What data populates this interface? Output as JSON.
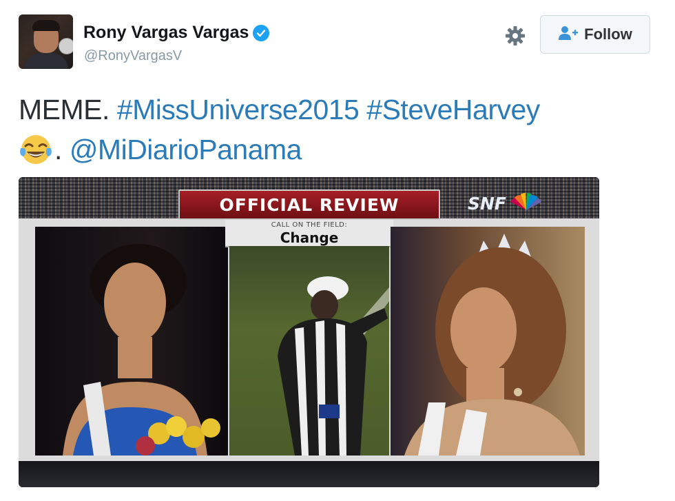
{
  "tweet": {
    "author": {
      "display_name": "Rony Vargas Vargas",
      "handle": "@RonyVargasV",
      "verified": true
    },
    "follow_button_label": "Follow",
    "text": {
      "prefix": "MEME.",
      "hashtag_1": "#MissUniverse2015",
      "hashtag_2": "#SteveHarvey",
      "emoji": "face-with-tears-of-joy",
      "separator": ".",
      "mention": "@MiDiarioPanama"
    },
    "media": {
      "banner_text": "OFFICIAL REVIEW",
      "network_logo_text": "SNF",
      "call_label": "CALL ON THE FIELD:",
      "call_value": "Change"
    }
  },
  "colors": {
    "link": "#2b7bb9",
    "verified_badge": "#1da1f2",
    "handle": "#8899a6",
    "banner_red": "#a51f25"
  },
  "icons": [
    "verified-badge-icon",
    "gear-icon",
    "follow-person-icon",
    "nbc-peacock-icon"
  ]
}
